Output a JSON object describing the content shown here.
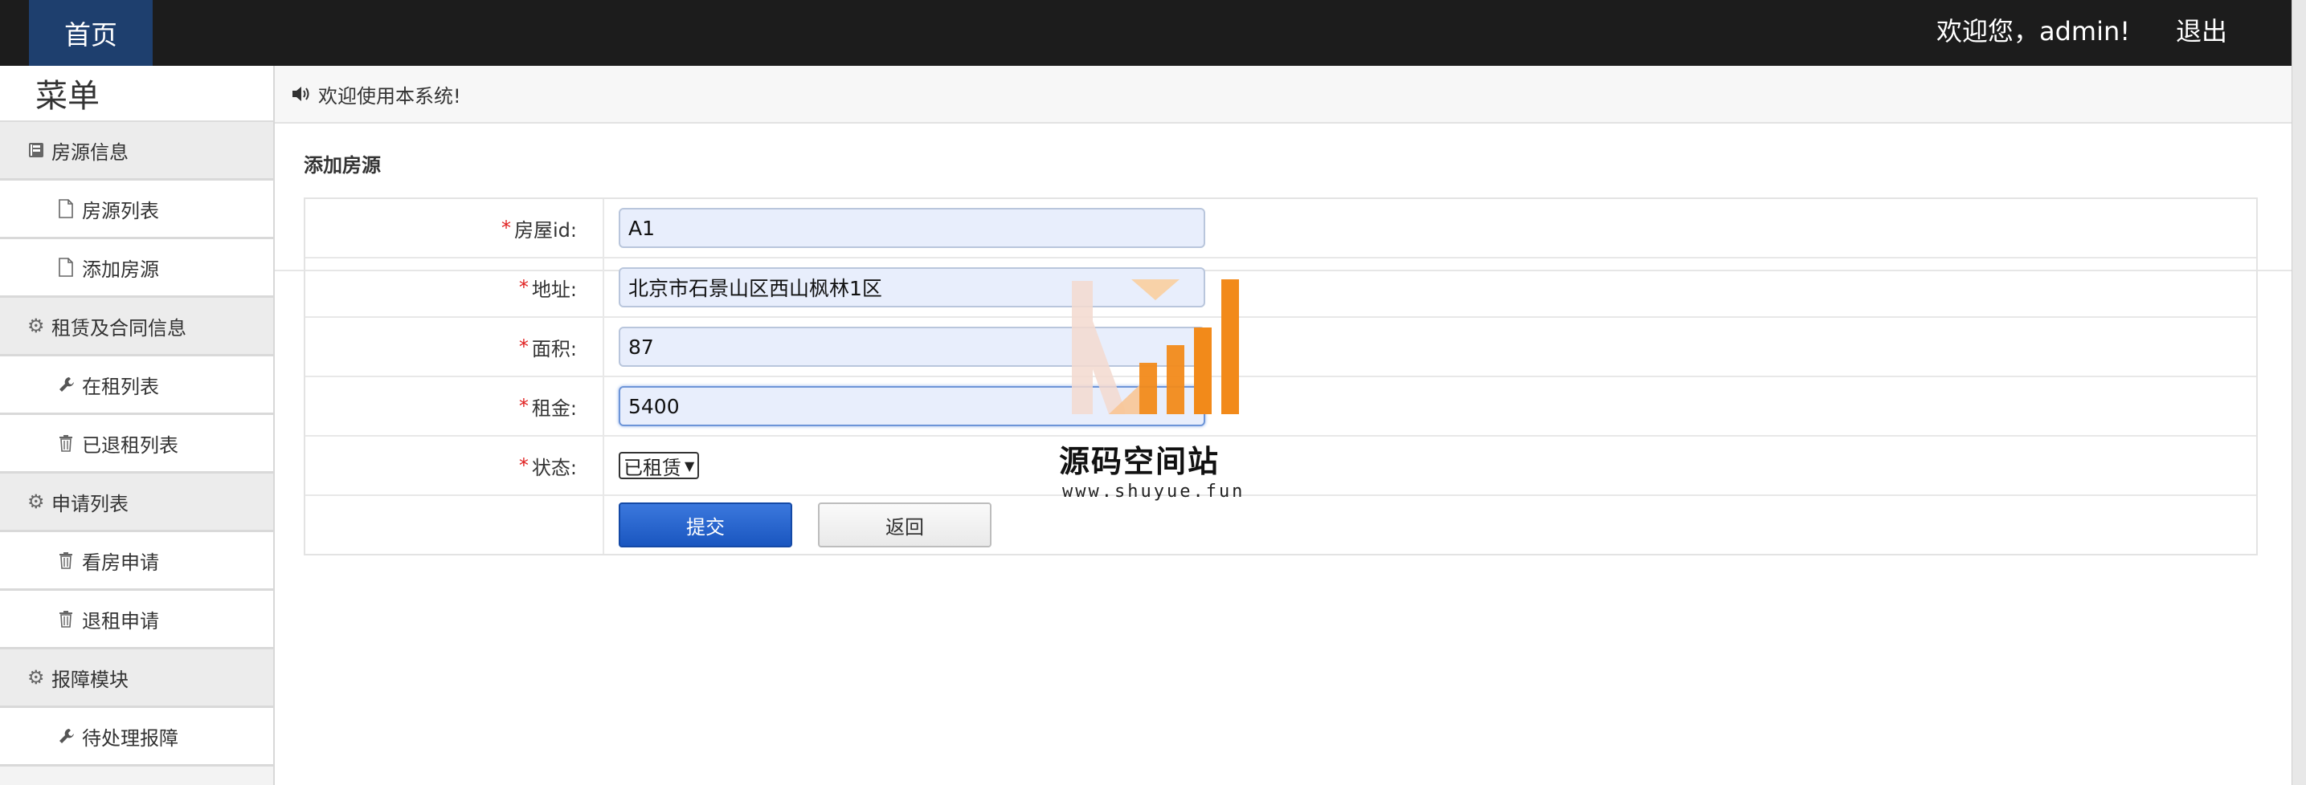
{
  "topbar": {
    "home_tab": "首页",
    "welcome": "欢迎您，admin!",
    "logout": "退出"
  },
  "sidebar": {
    "title": "菜单",
    "items": [
      {
        "label": "房源信息",
        "type": "group",
        "icon": "book-icon"
      },
      {
        "label": "房源列表",
        "type": "item",
        "icon": "file-icon"
      },
      {
        "label": "添加房源",
        "type": "item",
        "icon": "file-icon"
      },
      {
        "label": "租赁及合同信息",
        "type": "group",
        "icon": "gear-icon"
      },
      {
        "label": "在租列表",
        "type": "item",
        "icon": "wrench-icon"
      },
      {
        "label": "已退租列表",
        "type": "item",
        "icon": "trash-icon"
      },
      {
        "label": "申请列表",
        "type": "group",
        "icon": "gear-icon"
      },
      {
        "label": "看房申请",
        "type": "item",
        "icon": "trash-icon"
      },
      {
        "label": "退租申请",
        "type": "item",
        "icon": "trash-icon"
      },
      {
        "label": "报障模块",
        "type": "group",
        "icon": "gear-icon"
      },
      {
        "label": "待处理报障",
        "type": "item",
        "icon": "wrench-icon"
      }
    ]
  },
  "notice": "欢迎使用本系统!",
  "form": {
    "title": "添加房源",
    "required_mark": "*",
    "fields": {
      "house_id": {
        "label": "房屋id:",
        "value": "A1"
      },
      "address": {
        "label": "地址:",
        "value": "北京市石景山区西山枫林1区"
      },
      "area": {
        "label": "面积:",
        "value": "87"
      },
      "rent": {
        "label": "租金:",
        "value": "5400"
      },
      "status": {
        "label": "状态:",
        "value": "已租赁"
      }
    },
    "submit": "提交",
    "back": "返回"
  },
  "watermark": {
    "text": "源码空间站",
    "url": "www.shuyue.fun",
    "colors": {
      "light": "#f3d9cf",
      "orange": "#f28a1a"
    }
  },
  "colors": {
    "topbar": "#1c1c1c",
    "home_tab": "#1e3f6e",
    "submit": "#1a56c0",
    "required": "#e02020"
  }
}
